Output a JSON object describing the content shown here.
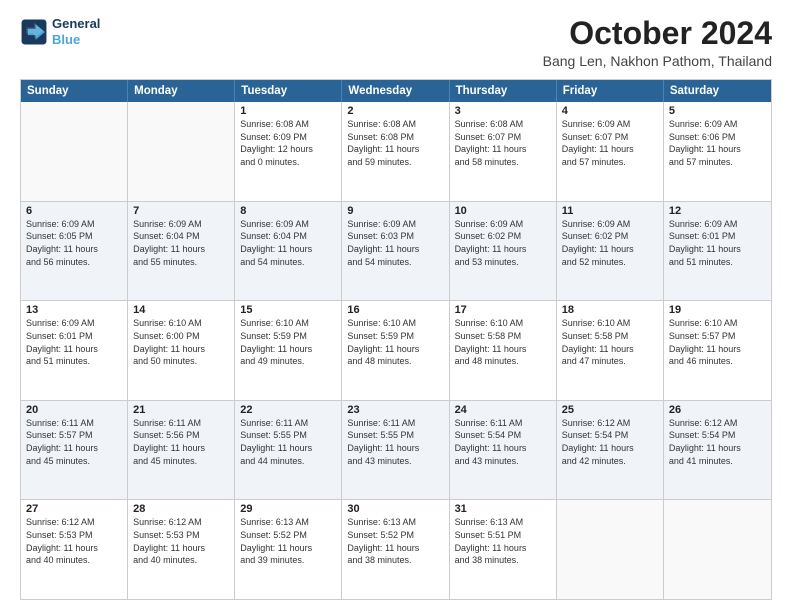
{
  "logo": {
    "line1": "General",
    "line2": "Blue"
  },
  "title": "October 2024",
  "location": "Bang Len, Nakhon Pathom, Thailand",
  "header_days": [
    "Sunday",
    "Monday",
    "Tuesday",
    "Wednesday",
    "Thursday",
    "Friday",
    "Saturday"
  ],
  "rows": [
    [
      {
        "day": "",
        "text": ""
      },
      {
        "day": "",
        "text": ""
      },
      {
        "day": "1",
        "text": "Sunrise: 6:08 AM\nSunset: 6:09 PM\nDaylight: 12 hours\nand 0 minutes."
      },
      {
        "day": "2",
        "text": "Sunrise: 6:08 AM\nSunset: 6:08 PM\nDaylight: 11 hours\nand 59 minutes."
      },
      {
        "day": "3",
        "text": "Sunrise: 6:08 AM\nSunset: 6:07 PM\nDaylight: 11 hours\nand 58 minutes."
      },
      {
        "day": "4",
        "text": "Sunrise: 6:09 AM\nSunset: 6:07 PM\nDaylight: 11 hours\nand 57 minutes."
      },
      {
        "day": "5",
        "text": "Sunrise: 6:09 AM\nSunset: 6:06 PM\nDaylight: 11 hours\nand 57 minutes."
      }
    ],
    [
      {
        "day": "6",
        "text": "Sunrise: 6:09 AM\nSunset: 6:05 PM\nDaylight: 11 hours\nand 56 minutes."
      },
      {
        "day": "7",
        "text": "Sunrise: 6:09 AM\nSunset: 6:04 PM\nDaylight: 11 hours\nand 55 minutes."
      },
      {
        "day": "8",
        "text": "Sunrise: 6:09 AM\nSunset: 6:04 PM\nDaylight: 11 hours\nand 54 minutes."
      },
      {
        "day": "9",
        "text": "Sunrise: 6:09 AM\nSunset: 6:03 PM\nDaylight: 11 hours\nand 54 minutes."
      },
      {
        "day": "10",
        "text": "Sunrise: 6:09 AM\nSunset: 6:02 PM\nDaylight: 11 hours\nand 53 minutes."
      },
      {
        "day": "11",
        "text": "Sunrise: 6:09 AM\nSunset: 6:02 PM\nDaylight: 11 hours\nand 52 minutes."
      },
      {
        "day": "12",
        "text": "Sunrise: 6:09 AM\nSunset: 6:01 PM\nDaylight: 11 hours\nand 51 minutes."
      }
    ],
    [
      {
        "day": "13",
        "text": "Sunrise: 6:09 AM\nSunset: 6:01 PM\nDaylight: 11 hours\nand 51 minutes."
      },
      {
        "day": "14",
        "text": "Sunrise: 6:10 AM\nSunset: 6:00 PM\nDaylight: 11 hours\nand 50 minutes."
      },
      {
        "day": "15",
        "text": "Sunrise: 6:10 AM\nSunset: 5:59 PM\nDaylight: 11 hours\nand 49 minutes."
      },
      {
        "day": "16",
        "text": "Sunrise: 6:10 AM\nSunset: 5:59 PM\nDaylight: 11 hours\nand 48 minutes."
      },
      {
        "day": "17",
        "text": "Sunrise: 6:10 AM\nSunset: 5:58 PM\nDaylight: 11 hours\nand 48 minutes."
      },
      {
        "day": "18",
        "text": "Sunrise: 6:10 AM\nSunset: 5:58 PM\nDaylight: 11 hours\nand 47 minutes."
      },
      {
        "day": "19",
        "text": "Sunrise: 6:10 AM\nSunset: 5:57 PM\nDaylight: 11 hours\nand 46 minutes."
      }
    ],
    [
      {
        "day": "20",
        "text": "Sunrise: 6:11 AM\nSunset: 5:57 PM\nDaylight: 11 hours\nand 45 minutes."
      },
      {
        "day": "21",
        "text": "Sunrise: 6:11 AM\nSunset: 5:56 PM\nDaylight: 11 hours\nand 45 minutes."
      },
      {
        "day": "22",
        "text": "Sunrise: 6:11 AM\nSunset: 5:55 PM\nDaylight: 11 hours\nand 44 minutes."
      },
      {
        "day": "23",
        "text": "Sunrise: 6:11 AM\nSunset: 5:55 PM\nDaylight: 11 hours\nand 43 minutes."
      },
      {
        "day": "24",
        "text": "Sunrise: 6:11 AM\nSunset: 5:54 PM\nDaylight: 11 hours\nand 43 minutes."
      },
      {
        "day": "25",
        "text": "Sunrise: 6:12 AM\nSunset: 5:54 PM\nDaylight: 11 hours\nand 42 minutes."
      },
      {
        "day": "26",
        "text": "Sunrise: 6:12 AM\nSunset: 5:54 PM\nDaylight: 11 hours\nand 41 minutes."
      }
    ],
    [
      {
        "day": "27",
        "text": "Sunrise: 6:12 AM\nSunset: 5:53 PM\nDaylight: 11 hours\nand 40 minutes."
      },
      {
        "day": "28",
        "text": "Sunrise: 6:12 AM\nSunset: 5:53 PM\nDaylight: 11 hours\nand 40 minutes."
      },
      {
        "day": "29",
        "text": "Sunrise: 6:13 AM\nSunset: 5:52 PM\nDaylight: 11 hours\nand 39 minutes."
      },
      {
        "day": "30",
        "text": "Sunrise: 6:13 AM\nSunset: 5:52 PM\nDaylight: 11 hours\nand 38 minutes."
      },
      {
        "day": "31",
        "text": "Sunrise: 6:13 AM\nSunset: 5:51 PM\nDaylight: 11 hours\nand 38 minutes."
      },
      {
        "day": "",
        "text": ""
      },
      {
        "day": "",
        "text": ""
      }
    ]
  ]
}
